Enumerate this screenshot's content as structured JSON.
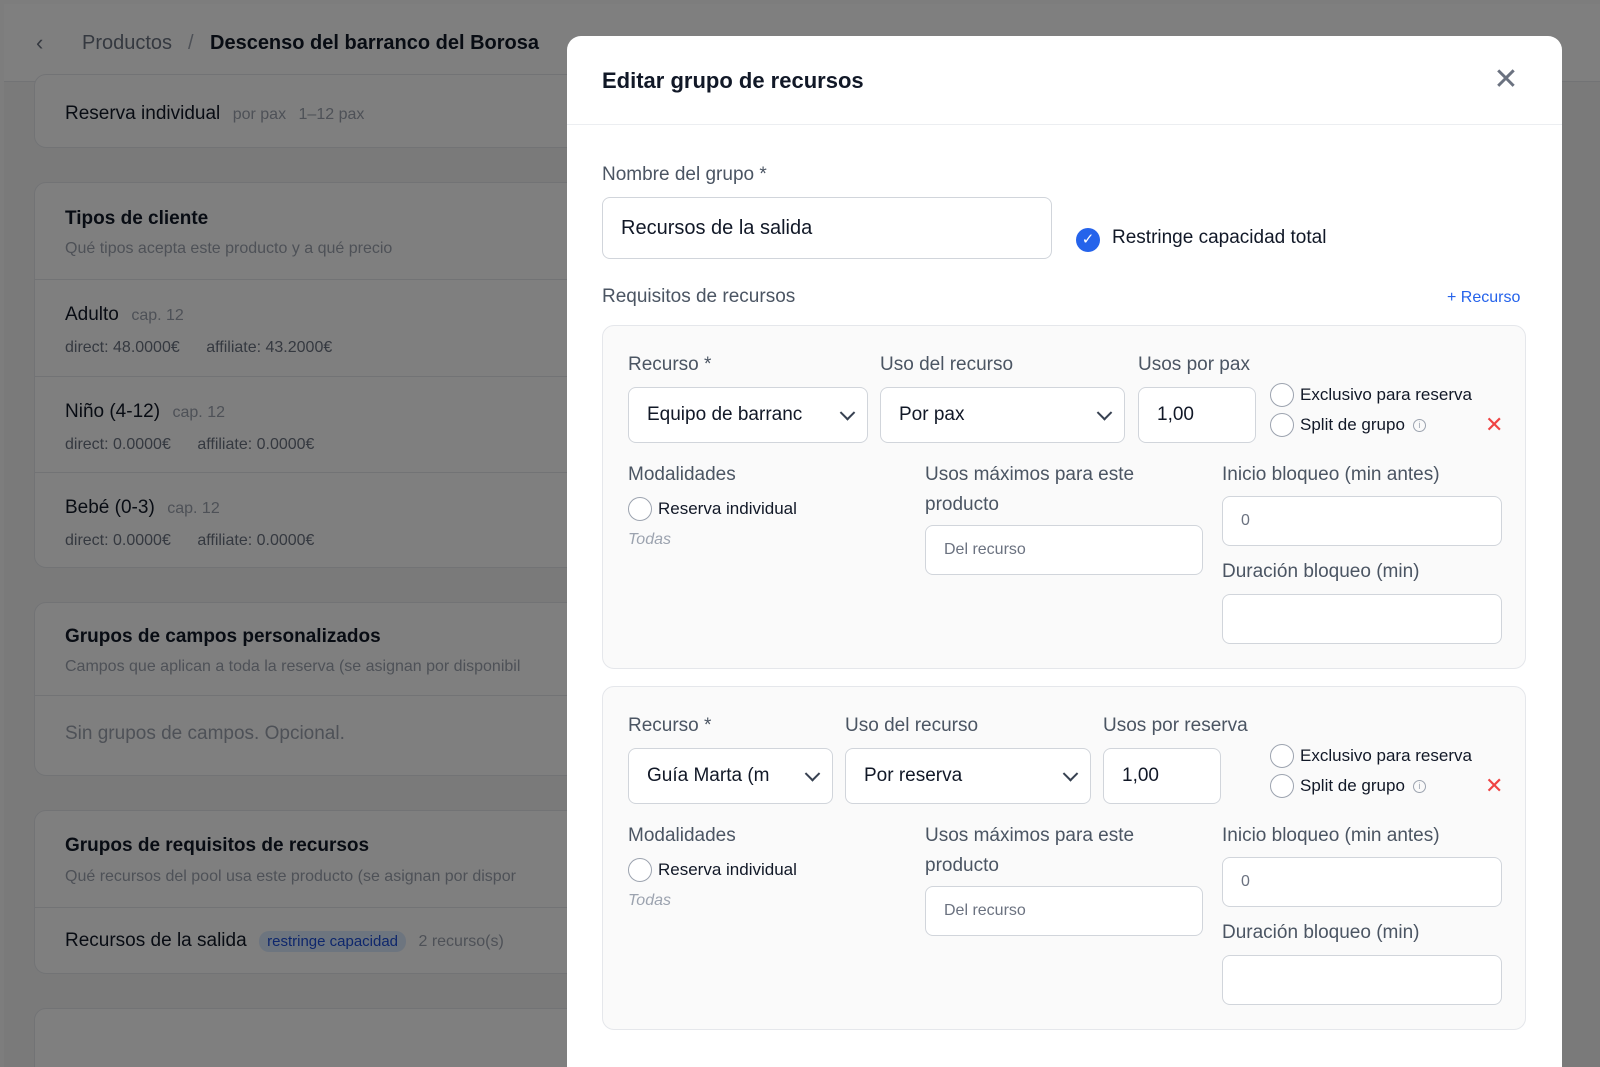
{
  "breadcrumb": {
    "back_icon": "chevron-left-icon",
    "parent": "Productos",
    "separator": "/",
    "current": "Descenso del barranco del Borosa"
  },
  "modalities_card": {
    "title": "Reserva individual",
    "meta1": "por pax",
    "meta2": "1–12 pax"
  },
  "customer_types": {
    "title": "Tipos de cliente",
    "subtitle": "Qué tipos acepta este producto y a qué precio",
    "items": [
      {
        "name": "Adulto",
        "cap": "cap. 12",
        "direct": "direct: 48.0000€",
        "affiliate": "affiliate: 43.2000€"
      },
      {
        "name": "Niño (4-12)",
        "cap": "cap. 12",
        "direct": "direct: 0.0000€",
        "affiliate": "affiliate: 0.0000€"
      },
      {
        "name": "Bebé (0-3)",
        "cap": "cap. 12",
        "direct": "direct: 0.0000€",
        "affiliate": "affiliate: 0.0000€"
      }
    ]
  },
  "custom_fields": {
    "title": "Grupos de campos personalizados",
    "subtitle": "Campos que aplican a toda la reserva (se asignan por disponibil",
    "empty": "Sin grupos de campos. Opcional."
  },
  "resource_groups": {
    "title": "Grupos de requisitos de recursos",
    "subtitle": "Qué recursos del pool usa este producto (se asignan por dispor",
    "item_name": "Recursos de la salida",
    "item_badge": "restringe capacidad",
    "item_count": "2 recurso(s)"
  },
  "modal": {
    "title": "Editar grupo de recursos",
    "close_icon": "close-icon",
    "group_name_label": "Nombre del grupo *",
    "group_name_value": "Recursos de la salida",
    "restrict_label": "Restringe capacidad total",
    "requirements_label": "Requisitos de recursos",
    "add_resource": "+ Recurso",
    "requirements": [
      {
        "resource_label": "Recurso *",
        "resource_value": "Equipo de barranc",
        "usage_label": "Uso del recurso",
        "usage_value": "Por pax",
        "uses_label": "Usos por pax",
        "uses_value": "1,00",
        "exclusive_label": "Exclusivo para reserva",
        "split_label": "Split de grupo",
        "modalities_label": "Modalidades",
        "modality_option": "Reserva individual",
        "modality_hint": "Todas",
        "max_uses_label_1": "Usos máximos para este",
        "max_uses_label_2": "producto",
        "max_uses_placeholder": "Del recurso",
        "block_start_label": "Inicio bloqueo (min antes)",
        "block_start_value": "0",
        "block_duration_label": "Duración bloqueo (min)",
        "block_duration_value": ""
      },
      {
        "resource_label": "Recurso *",
        "resource_value": "Guía Marta (m",
        "usage_label": "Uso del recurso",
        "usage_value": "Por reserva",
        "uses_label": "Usos por reserva",
        "uses_value": "1,00",
        "exclusive_label": "Exclusivo para reserva",
        "split_label": "Split de grupo",
        "modalities_label": "Modalidades",
        "modality_option": "Reserva individual",
        "modality_hint": "Todas",
        "max_uses_label_1": "Usos máximos para este",
        "max_uses_label_2": "producto",
        "max_uses_placeholder": "Del recurso",
        "block_start_label": "Inicio bloqueo (min antes)",
        "block_start_value": "0",
        "block_duration_label": "Duración bloqueo (min)",
        "block_duration_value": ""
      }
    ]
  },
  "colors": {
    "accent": "#2563eb",
    "danger": "#ef4444",
    "badge_bg": "#dbeafe"
  }
}
